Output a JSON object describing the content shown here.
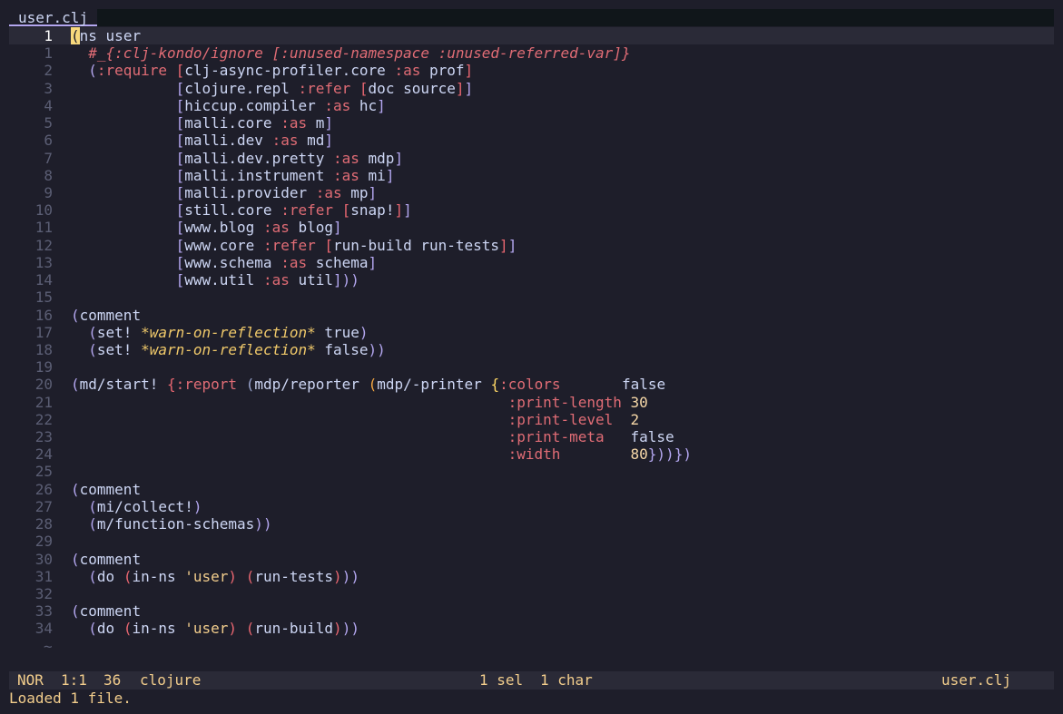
{
  "tab": {
    "label": "user.clj"
  },
  "editor": {
    "lines": [
      {
        "n": "1",
        "current": true,
        "code": "ns user"
      },
      {
        "n": "1",
        "code": "  #_{:clj-kondo/ignore [:unused-namespace :unused-referred-var]}"
      },
      {
        "n": "2",
        "code": "  (:require [clj-async-profiler.core :as prof]"
      },
      {
        "n": "3",
        "code": "            [clojure.repl :refer [doc source]]"
      },
      {
        "n": "4",
        "code": "            [hiccup.compiler :as hc]"
      },
      {
        "n": "5",
        "code": "            [malli.core :as m]"
      },
      {
        "n": "6",
        "code": "            [malli.dev :as md]"
      },
      {
        "n": "7",
        "code": "            [malli.dev.pretty :as mdp]"
      },
      {
        "n": "8",
        "code": "            [malli.instrument :as mi]"
      },
      {
        "n": "9",
        "code": "            [malli.provider :as mp]"
      },
      {
        "n": "10",
        "code": "            [still.core :refer [snap!]]"
      },
      {
        "n": "11",
        "code": "            [www.blog :as blog]"
      },
      {
        "n": "12",
        "code": "            [www.core :refer [run-build run-tests]]"
      },
      {
        "n": "13",
        "code": "            [www.schema :as schema]"
      },
      {
        "n": "14",
        "code": "            [www.util :as util]))"
      },
      {
        "n": "15",
        "code": ""
      },
      {
        "n": "16",
        "code": "(comment"
      },
      {
        "n": "17",
        "code": "  (set! *warn-on-reflection* true)"
      },
      {
        "n": "18",
        "code": "  (set! *warn-on-reflection* false))"
      },
      {
        "n": "19",
        "code": ""
      },
      {
        "n": "20",
        "code": "(md/start! {:report (mdp/reporter (mdp/-printer {:colors       false"
      },
      {
        "n": "21",
        "code": "                                                  :print-length 30"
      },
      {
        "n": "22",
        "code": "                                                  :print-level  2"
      },
      {
        "n": "23",
        "code": "                                                  :print-meta   false"
      },
      {
        "n": "24",
        "code": "                                                  :width        80}))})"
      },
      {
        "n": "25",
        "code": ""
      },
      {
        "n": "26",
        "code": "(comment"
      },
      {
        "n": "27",
        "code": "  (mi/collect!)"
      },
      {
        "n": "28",
        "code": "  (m/function-schemas))"
      },
      {
        "n": "29",
        "code": ""
      },
      {
        "n": "30",
        "code": "(comment"
      },
      {
        "n": "31",
        "code": "  (do (in-ns 'user) (run-tests)))"
      },
      {
        "n": "32",
        "code": ""
      },
      {
        "n": "33",
        "code": "(comment"
      },
      {
        "n": "34",
        "code": "  (do (in-ns 'user) (run-build)))"
      }
    ],
    "cursor_char": "(",
    "tilde": "~"
  },
  "statusbar": {
    "mode": "NOR",
    "position": "1:1",
    "count": "36",
    "language": "clojure",
    "selection": "1 sel",
    "chars": "1 char",
    "filename": "user.clj"
  },
  "message": "Loaded 1 file.",
  "colors": {
    "background": "#1e1e2a",
    "keyword": "#e06c75",
    "string": "#f2cd8c",
    "accent": "#b4a7f0"
  }
}
